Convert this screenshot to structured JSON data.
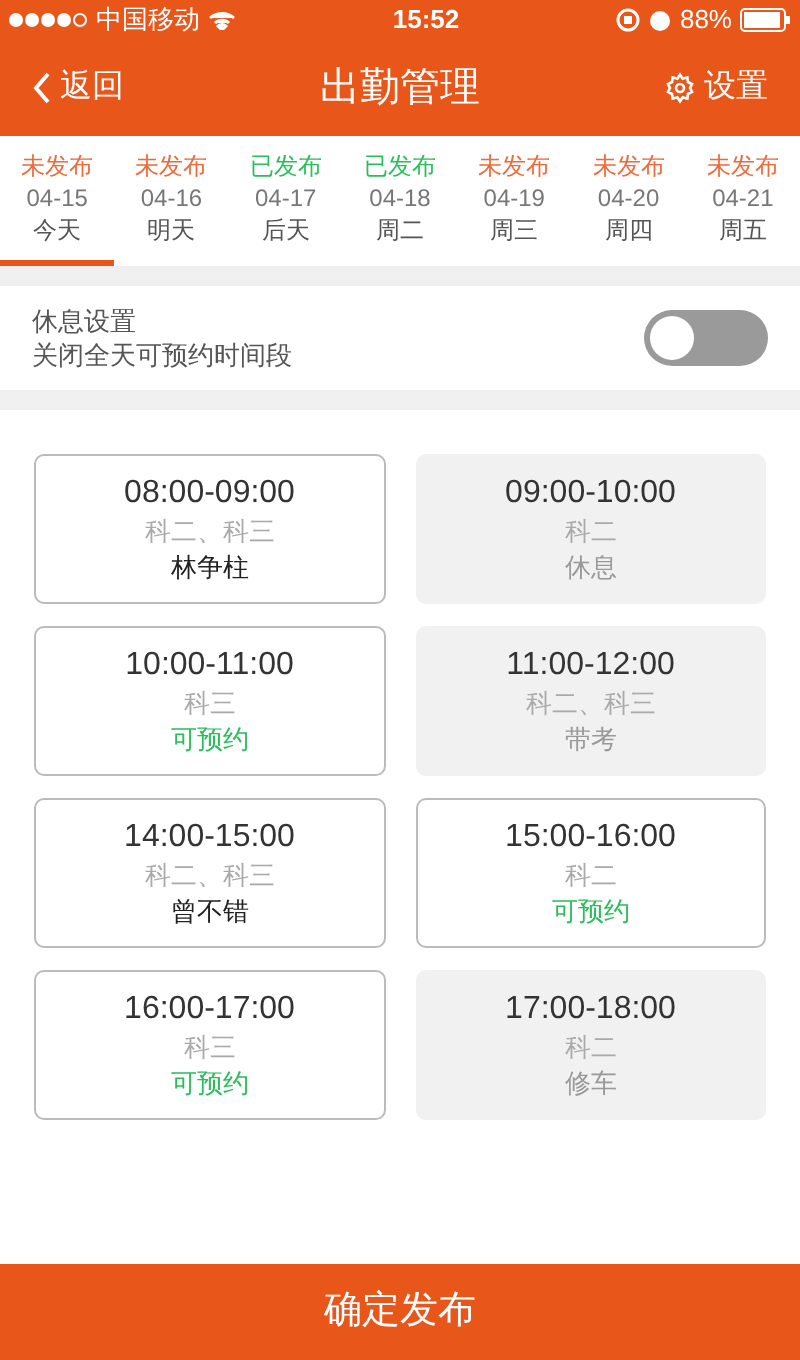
{
  "status_bar": {
    "carrier": "中国移动",
    "time": "15:52",
    "battery": "88%"
  },
  "nav": {
    "back": "返回",
    "title": "出勤管理",
    "settings": "设置"
  },
  "days": [
    {
      "status": "未发布",
      "published": false,
      "date": "04-15",
      "label": "今天",
      "selected": true
    },
    {
      "status": "未发布",
      "published": false,
      "date": "04-16",
      "label": "明天",
      "selected": false
    },
    {
      "status": "已发布",
      "published": true,
      "date": "04-17",
      "label": "后天",
      "selected": false
    },
    {
      "status": "已发布",
      "published": true,
      "date": "04-18",
      "label": "周二",
      "selected": false
    },
    {
      "status": "未发布",
      "published": false,
      "date": "04-19",
      "label": "周三",
      "selected": false
    },
    {
      "status": "未发布",
      "published": false,
      "date": "04-20",
      "label": "周四",
      "selected": false
    },
    {
      "status": "未发布",
      "published": false,
      "date": "04-21",
      "label": "周五",
      "selected": false
    }
  ],
  "rest": {
    "title": "休息设置",
    "subtitle": "关闭全天可预约时间段",
    "on": false
  },
  "slots": [
    {
      "time": "08:00-09:00",
      "subjects": "科二、科三",
      "note": "林争柱",
      "kind": "booked"
    },
    {
      "time": "09:00-10:00",
      "subjects": "科二",
      "note": "休息",
      "kind": "closed"
    },
    {
      "time": "10:00-11:00",
      "subjects": "科三",
      "note": "可预约",
      "kind": "open"
    },
    {
      "time": "11:00-12:00",
      "subjects": "科二、科三",
      "note": "带考",
      "kind": "closed"
    },
    {
      "time": "14:00-15:00",
      "subjects": "科二、科三",
      "note": "曾不错",
      "kind": "booked"
    },
    {
      "time": "15:00-16:00",
      "subjects": "科二",
      "note": "可预约",
      "kind": "open"
    },
    {
      "time": "16:00-17:00",
      "subjects": "科三",
      "note": "可预约",
      "kind": "open"
    },
    {
      "time": "17:00-18:00",
      "subjects": "科二",
      "note": "修车",
      "kind": "closed"
    }
  ],
  "publish_button": "确定发布"
}
